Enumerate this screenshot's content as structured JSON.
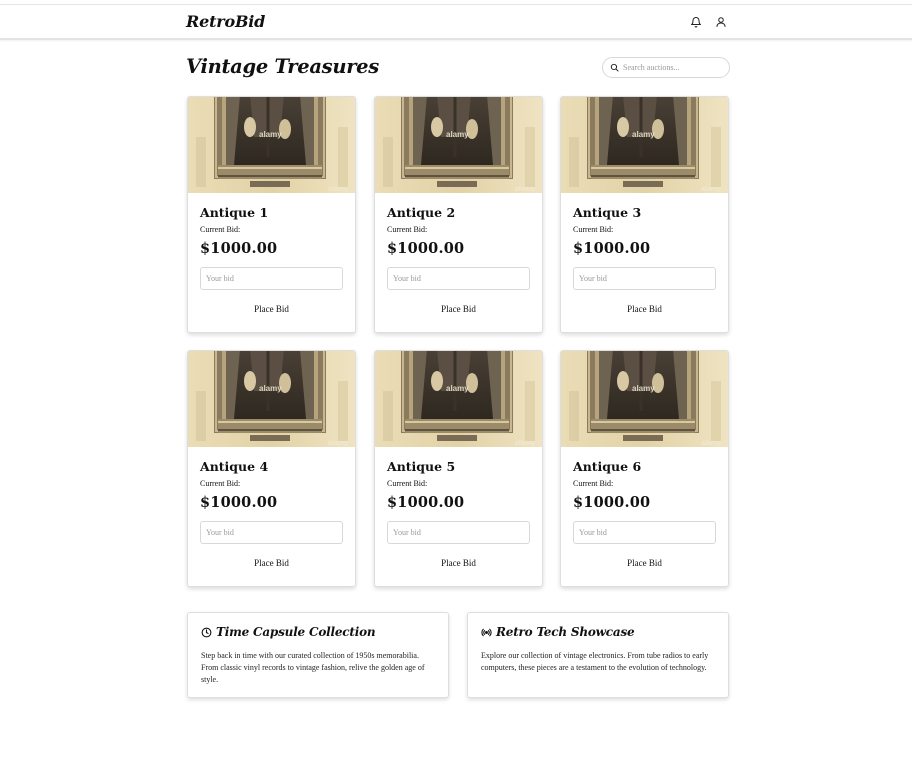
{
  "header": {
    "brand": "RetroBid",
    "icons": [
      "bell-icon",
      "user-icon"
    ]
  },
  "main": {
    "title": "Vintage Treasures",
    "search": {
      "placeholder": "Search auctions...",
      "value": ""
    }
  },
  "auctions": [
    {
      "name": "Antique 1",
      "bid_label": "Current Bid:",
      "price": "$1000.00",
      "input_placeholder": "Your bid",
      "button_label": "Place Bid",
      "image_watermark": "alamy"
    },
    {
      "name": "Antique 2",
      "bid_label": "Current Bid:",
      "price": "$1000.00",
      "input_placeholder": "Your bid",
      "button_label": "Place Bid",
      "image_watermark": "alamy"
    },
    {
      "name": "Antique 3",
      "bid_label": "Current Bid:",
      "price": "$1000.00",
      "input_placeholder": "Your bid",
      "button_label": "Place Bid",
      "image_watermark": "alamy"
    },
    {
      "name": "Antique 4",
      "bid_label": "Current Bid:",
      "price": "$1000.00",
      "input_placeholder": "Your bid",
      "button_label": "Place Bid",
      "image_watermark": "alamy"
    },
    {
      "name": "Antique 5",
      "bid_label": "Current Bid:",
      "price": "$1000.00",
      "input_placeholder": "Your bid",
      "button_label": "Place Bid",
      "image_watermark": "alamy"
    },
    {
      "name": "Antique 6",
      "bid_label": "Current Bid:",
      "price": "$1000.00",
      "input_placeholder": "Your bid",
      "button_label": "Place Bid",
      "image_watermark": "alamy"
    }
  ],
  "features": [
    {
      "icon": "clock-icon",
      "title": "Time Capsule Collection",
      "text": "Step back in time with our curated collection of 1950s memorabilia. From classic vinyl records to vintage fashion, relive the golden age of style."
    },
    {
      "icon": "broadcast-icon",
      "title": "Retro Tech Showcase",
      "text": "Explore our collection of vintage electronics. From tube radios to early computers, these pieces are a testament to the evolution of technology."
    }
  ],
  "colors": {
    "sepia_light": "#e8d8b0",
    "sepia_dark": "#3c3328",
    "border": "#dedede",
    "text": "#111111"
  }
}
